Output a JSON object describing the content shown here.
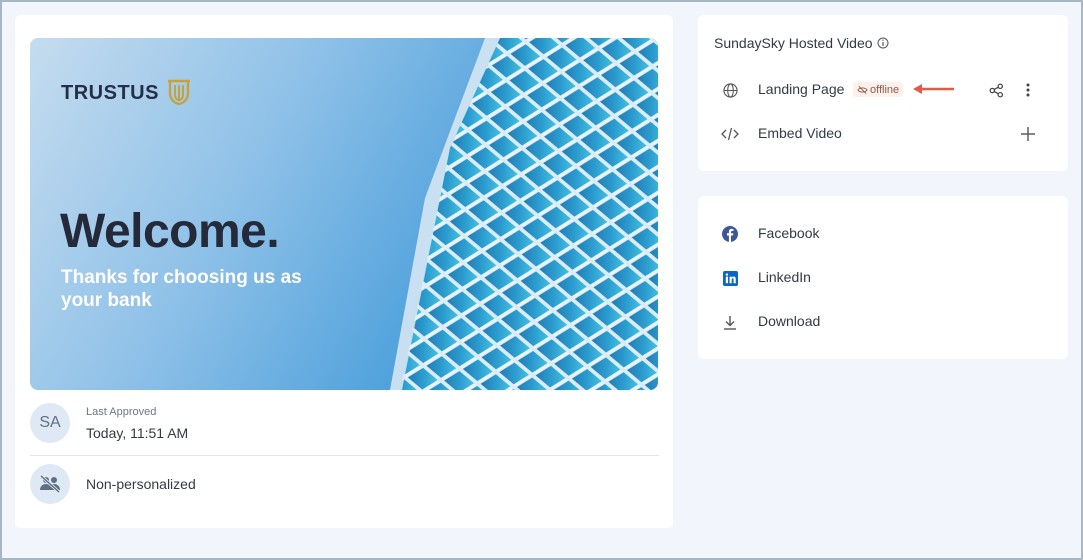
{
  "thumbnail": {
    "brand": "TRUSTUS",
    "headline": "Welcome.",
    "tagline": "Thanks for choosing us as your bank"
  },
  "approval": {
    "avatar_initials": "SA",
    "label": "Last Approved",
    "value": "Today, 11:51 AM"
  },
  "personalization": {
    "label": "Non-personalized"
  },
  "hosted_video": {
    "title": "SundaySky Hosted Video",
    "items": [
      {
        "label": "Landing Page",
        "icon": "globe-icon",
        "badge": "offline"
      },
      {
        "label": "Embed Video",
        "icon": "code-icon"
      }
    ]
  },
  "share": {
    "items": [
      {
        "label": "Facebook",
        "icon": "facebook-icon"
      },
      {
        "label": "LinkedIn",
        "icon": "linkedin-icon"
      },
      {
        "label": "Download",
        "icon": "download-icon"
      }
    ]
  },
  "colors": {
    "background": "#f2f6fc",
    "card": "#ffffff",
    "accent_red": "#e05a4e",
    "facebook": "#3b5998",
    "linkedin": "#0a66c2"
  }
}
